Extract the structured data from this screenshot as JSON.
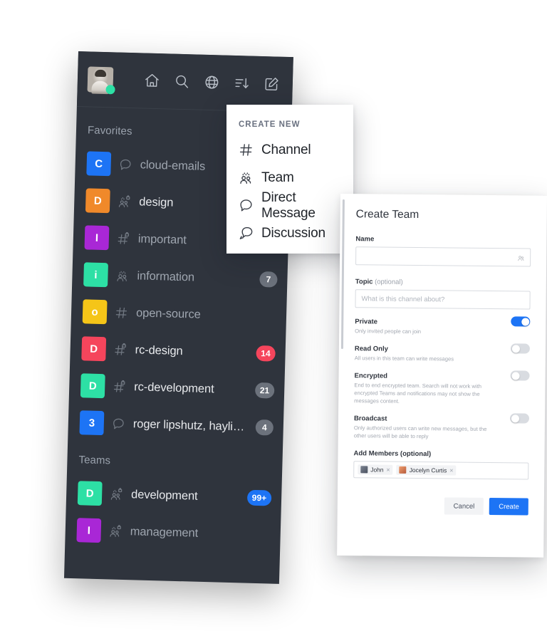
{
  "sidebar": {
    "topbar": {
      "avatar_name": "user-avatar",
      "status": "online",
      "icons": [
        {
          "name": "home-icon",
          "label": "Home"
        },
        {
          "name": "search-icon",
          "label": "Search"
        },
        {
          "name": "globe-icon",
          "label": "Directory"
        },
        {
          "name": "sort-icon",
          "label": "Sort"
        },
        {
          "name": "compose-icon",
          "label": "Create new"
        }
      ]
    },
    "sections": [
      {
        "title": "Favorites",
        "items": [
          {
            "initial": "C",
            "color": "#1d74f5",
            "name": "cloud-emails",
            "icon": "discussion-icon",
            "badge": "",
            "badge_color": "",
            "active": false
          },
          {
            "initial": "D",
            "color": "#f0892a",
            "name": "design",
            "icon": "team-private-icon",
            "badge": "",
            "badge_color": "",
            "active": true
          },
          {
            "initial": "I",
            "color": "#a927d6",
            "name": "important",
            "icon": "channel-private-icon",
            "badge": "",
            "badge_color": "",
            "active": false
          },
          {
            "initial": "i",
            "color": "#2de0a5",
            "name": "information",
            "icon": "team-icon",
            "badge": "7",
            "badge_color": "gray",
            "active": false
          },
          {
            "initial": "o",
            "color": "#f5c518",
            "name": "open-source",
            "icon": "channel-icon",
            "badge": "",
            "badge_color": "",
            "active": false
          },
          {
            "initial": "D",
            "color": "#f5455c",
            "name": "rc-design",
            "icon": "channel-private-icon",
            "badge": "14",
            "badge_color": "red",
            "active": true
          },
          {
            "initial": "D",
            "color": "#2de0a5",
            "name": "rc-development",
            "icon": "channel-private-icon",
            "badge": "21",
            "badge_color": "gray",
            "active": true
          },
          {
            "initial": "3",
            "color": "#1d74f5",
            "name": "roger lipshutz, haylie p...",
            "icon": "discussion-icon",
            "badge": "4",
            "badge_color": "gray",
            "active": true
          }
        ]
      },
      {
        "title": "Teams",
        "items": [
          {
            "initial": "D",
            "color": "#2de0a5",
            "name": "development",
            "icon": "team-private-icon",
            "badge": "99+",
            "badge_color": "blue",
            "active": true
          },
          {
            "initial": "I",
            "color": "#a927d6",
            "name": "management",
            "icon": "team-private-icon",
            "badge": "",
            "badge_color": "",
            "active": false
          }
        ]
      }
    ]
  },
  "create_menu": {
    "title": "CREATE NEW",
    "items": [
      {
        "label": "Channel",
        "icon": "channel-icon"
      },
      {
        "label": "Team",
        "icon": "team-icon"
      },
      {
        "label": "Direct Message",
        "icon": "discussion-icon"
      },
      {
        "label": "Discussion",
        "icon": "discussion-alt-icon"
      }
    ]
  },
  "dialog": {
    "title": "Create Team",
    "name_field": {
      "label": "Name",
      "value": "",
      "placeholder": "",
      "trailing_icon": "team-icon"
    },
    "topic_field": {
      "label": "Topic",
      "optional_suffix": "(optional)",
      "value": "",
      "placeholder": "What is this channel about?"
    },
    "options": [
      {
        "name": "Private",
        "desc": "Only invited people can join",
        "on": true
      },
      {
        "name": "Read Only",
        "desc": "All users in this team can write messages",
        "on": false
      },
      {
        "name": "Encrypted",
        "desc": "End to end encrypted team. Search will not work with encrypted Teams and notifications may not show the messages content.",
        "on": false
      },
      {
        "name": "Broadcast",
        "desc": "Only authorized users can write new messages, but the other users will be able to reply",
        "on": false
      }
    ],
    "members": {
      "label": "Add Members (optional)",
      "chips": [
        {
          "name": "John",
          "remove_label": "×"
        },
        {
          "name": "Jocelyn Curtis",
          "remove_label": "×"
        }
      ]
    },
    "actions": {
      "cancel": "Cancel",
      "create": "Create"
    }
  },
  "colors": {
    "sidebar_bg": "#2f343d",
    "accent_blue": "#1d74f5",
    "badge_red": "#f5455c",
    "badge_gray": "#6c727c",
    "online_green": "#2de0a5"
  }
}
